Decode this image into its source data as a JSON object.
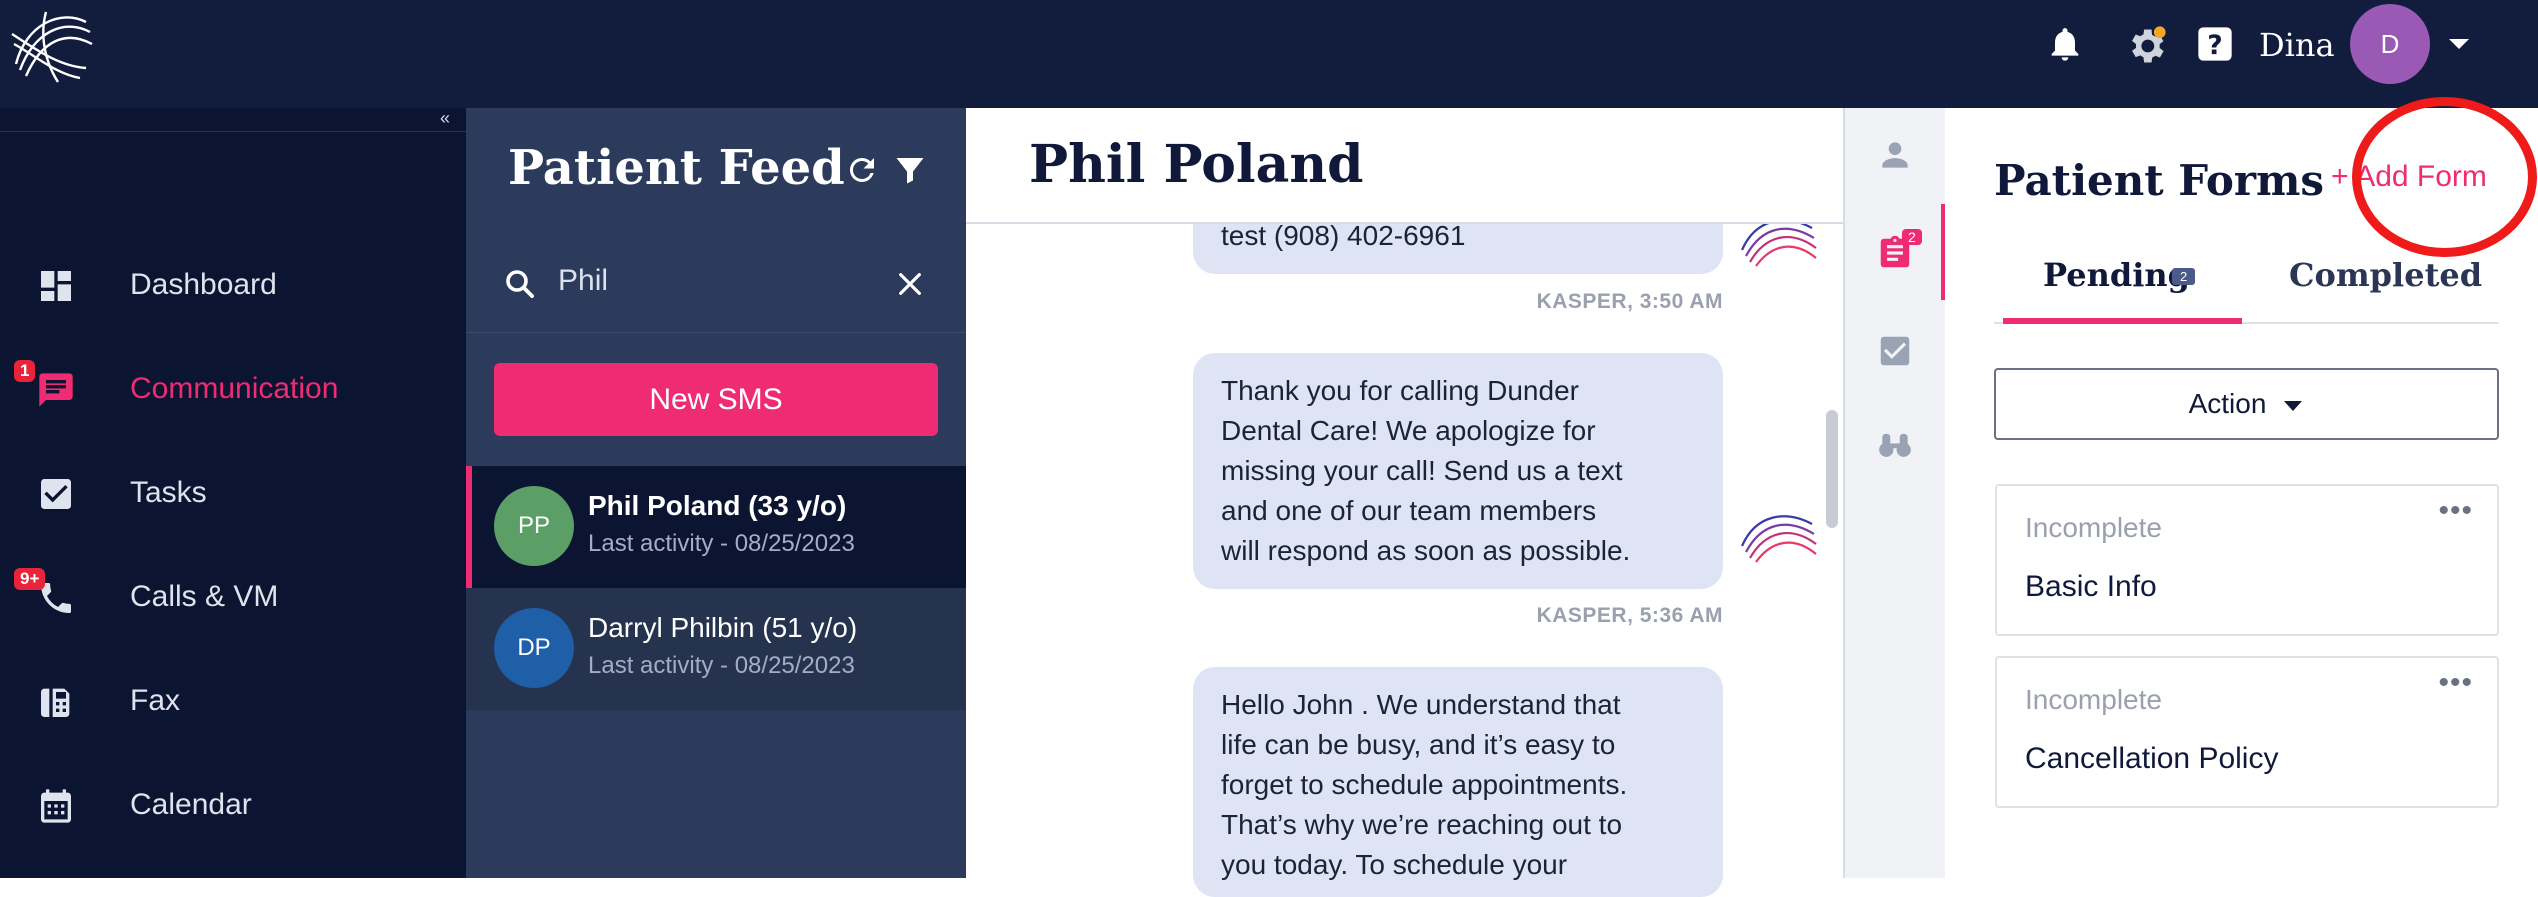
{
  "topbar": {
    "username": "Dina",
    "avatar_initial": "D"
  },
  "sidebar": {
    "collapse_label": "«",
    "items": [
      {
        "label": "Dashboard",
        "icon": "dashboard-icon"
      },
      {
        "label": "Communication",
        "icon": "chat-icon",
        "badge": "1"
      },
      {
        "label": "Tasks",
        "icon": "checkbox-icon"
      },
      {
        "label": "Calls & VM",
        "icon": "phone-icon",
        "badge": "9+"
      },
      {
        "label": "Fax",
        "icon": "fax-icon"
      },
      {
        "label": "Calendar",
        "icon": "calendar-icon"
      }
    ]
  },
  "feed": {
    "title": "Patient Feed",
    "search_value": "Phil",
    "new_sms_label": "New SMS",
    "patients": [
      {
        "initials": "PP",
        "name": "Phil Poland (33 y/o)",
        "activity": "Last activity - 08/25/2023",
        "avatar_color": "#5b9e66"
      },
      {
        "initials": "DP",
        "name": "Darryl Philbin (51 y/o)",
        "activity": "Last activity - 08/25/2023",
        "avatar_color": "#1f5fa8"
      }
    ]
  },
  "chat": {
    "title": "Phil Poland",
    "messages": [
      {
        "lines": [
          "test (908) 402-6961"
        ],
        "meta": "KASPER, 3:50 AM"
      },
      {
        "lines": [
          "Thank you for calling Dunder",
          "Dental Care! We apologize for",
          "missing your call! Send us a text",
          "and one of our team members",
          "will respond as soon as possible."
        ],
        "meta": "KASPER, 5:36 AM"
      },
      {
        "lines": [
          "Hello John  . We understand that",
          "life can be busy, and it’s easy to",
          "forget to schedule appointments.",
          "That’s why we’re reaching out to",
          "you today. To schedule your"
        ],
        "meta": ""
      }
    ]
  },
  "strip": {
    "forms_badge": "2"
  },
  "forms": {
    "title": "Patient Forms",
    "add_form_label": "+ Add Form",
    "tabs": {
      "pending": "Pending",
      "pending_count": "2",
      "completed": "Completed"
    },
    "action_label": "Action",
    "cards": [
      {
        "status": "Incomplete",
        "name": "Basic Info",
        "menu": "•••"
      },
      {
        "status": "Incomplete",
        "name": "Cancellation Policy",
        "menu": "•••"
      }
    ]
  },
  "colors": {
    "accent": "#ef2b74",
    "navy": "#121d3d",
    "sidebar": "#0b1532",
    "feed": "#2c3a5b",
    "highlight_circle": "#ef1a1a"
  }
}
